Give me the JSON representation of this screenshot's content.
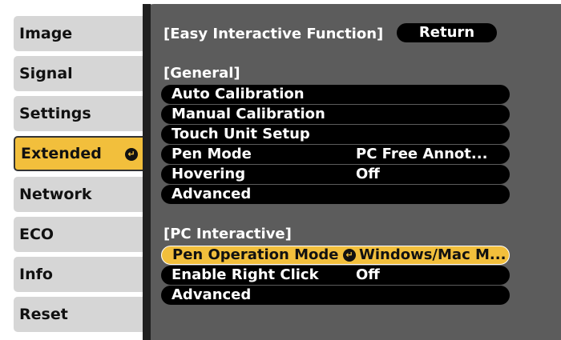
{
  "sidebar": {
    "items": [
      {
        "label": "Image"
      },
      {
        "label": "Signal"
      },
      {
        "label": "Settings"
      },
      {
        "label": "Extended",
        "active": true
      },
      {
        "label": "Network"
      },
      {
        "label": "ECO"
      },
      {
        "label": "Info"
      },
      {
        "label": "Reset"
      }
    ],
    "enter_icon": "↵"
  },
  "panel": {
    "title": "[Easy Interactive Function]",
    "return_label": "Return",
    "general_header": "[General]",
    "general_items": [
      {
        "label": "Auto Calibration",
        "value": ""
      },
      {
        "label": "Manual Calibration",
        "value": ""
      },
      {
        "label": "Touch Unit Setup",
        "value": ""
      },
      {
        "label": "Pen Mode",
        "value": "PC Free Annot..."
      },
      {
        "label": "Hovering",
        "value": "Off"
      },
      {
        "label": "Advanced",
        "value": ""
      }
    ],
    "pc_header": "[PC Interactive]",
    "pc_items": [
      {
        "label": "Pen Operation Mode",
        "value": "Windows/Mac M...",
        "selected": true
      },
      {
        "label": "Enable Right Click",
        "value": "Off"
      },
      {
        "label": "Advanced",
        "value": ""
      }
    ]
  },
  "colors": {
    "accent": "#f2bf3c",
    "panel": "#5c5c5c",
    "tab": "#d6d6d6",
    "row": "#000000"
  }
}
